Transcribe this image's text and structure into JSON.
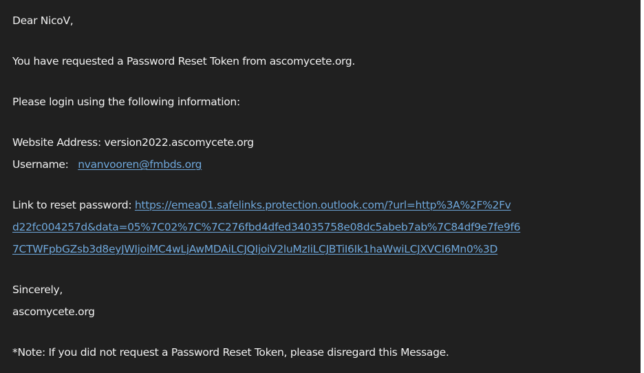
{
  "email": {
    "greeting": "Dear NicoV,",
    "intro": "You have requested a Password Reset Token from ascomycete.org.",
    "instruction": "Please login using the following information:",
    "website_address_label": "Website Address:",
    "website_address_value": "version2022.ascomycete.org",
    "username_label": "Username:",
    "username_value": "nvanvooren@fmbds.org",
    "reset_link_label": "Link to reset password:",
    "reset_link_line1": "https://emea01.safelinks.protection.outlook.com/?url=http%3A%2F%2Fv",
    "reset_link_line2": "d22fc004257d&data=05%7C02%7C%7C276fbd4dfed34035758e08dc5abeb7ab%7C84df9e7fe9f6",
    "reset_link_line3": "7CTWFpbGZsb3d8eyJWIjoiMC4wLjAwMDAiLCJQIjoiV2luMzIiLCJBTiI6Ik1haWwiLCJXVCI6Mn0%3D",
    "closing": "Sincerely,",
    "signature": "ascomycete.org",
    "note": "*Note: If you did not request a Password Reset Token, please disregard this Message."
  },
  "colors": {
    "background": "#202020",
    "text": "#f1f1f1",
    "link": "#6fa8dc"
  }
}
